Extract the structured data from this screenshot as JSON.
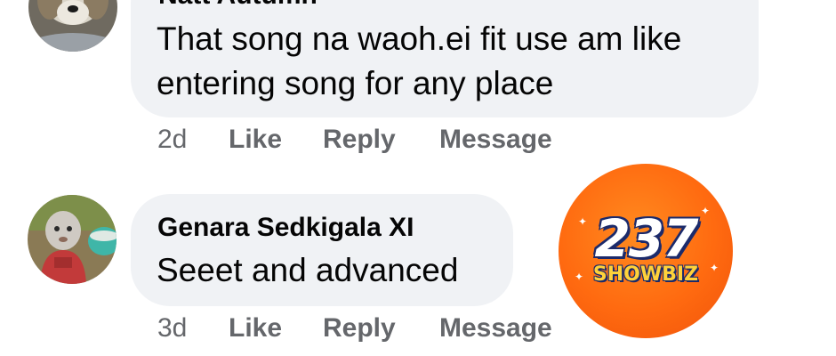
{
  "comments": [
    {
      "author": "Natt Autumn",
      "text_lines": [
        "That song na waoh.ei fit use am like",
        "entering song for any place"
      ],
      "time": "2d",
      "actions": {
        "like": "Like",
        "reply": "Reply",
        "message": "Message"
      }
    },
    {
      "author": "Genara Sedkigala XI",
      "text_lines": [
        "Seeet and advanced"
      ],
      "time": "3d",
      "actions": {
        "like": "Like",
        "reply": "Reply",
        "message": "Message"
      }
    }
  ],
  "watermark": {
    "number": "237",
    "word": "SHOWBIZ",
    "color": "#ff6a10"
  },
  "colors": {
    "bubble": "#f0f2f5",
    "text": "#050505",
    "meta": "#65676b"
  }
}
